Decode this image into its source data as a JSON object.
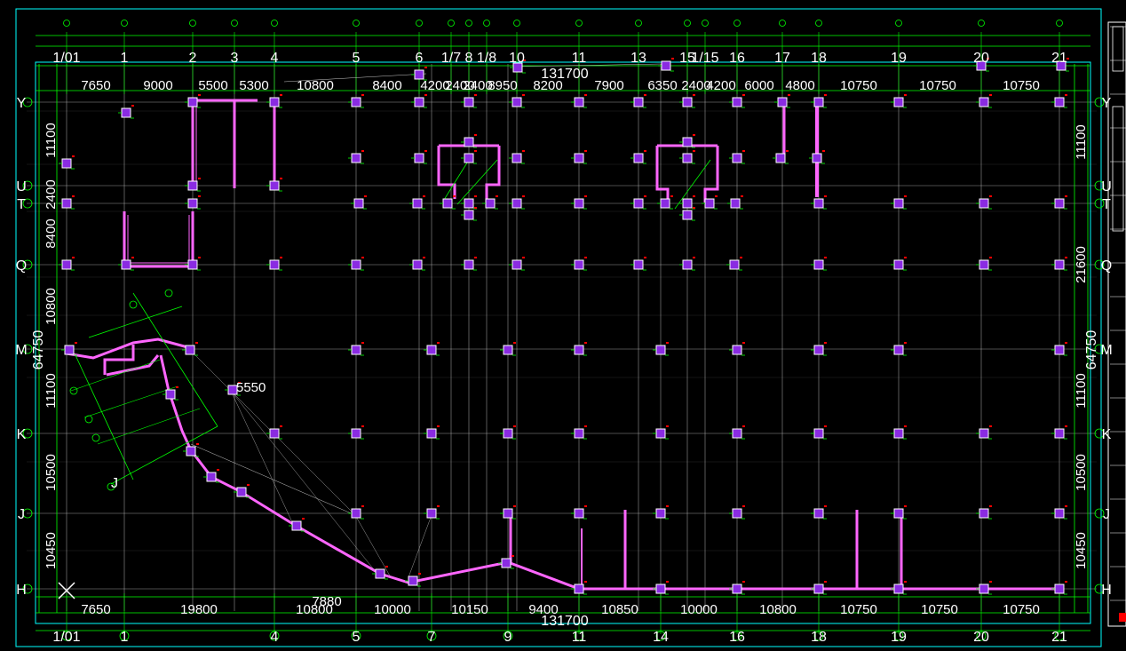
{
  "colors": {
    "background": "#000000",
    "grid": "#c8c8c8",
    "dim": "#00ff00",
    "wall": "#ff66ff",
    "column_fill": "#8a2be2",
    "column_edge": "#ffffff",
    "text": "#ffffff",
    "frame": "#00ffff",
    "marker": "#ff0000"
  },
  "axes_x_top": [
    "1/01",
    "1",
    "2",
    "3",
    "4",
    "5",
    "6",
    "1/7",
    "8",
    "1/8",
    "10",
    "11",
    "13",
    "15",
    "1/15",
    "16",
    "17",
    "18",
    "19",
    "20",
    "21"
  ],
  "axes_x_bottom": [
    "1/01",
    "1",
    "4",
    "5",
    "7",
    "9",
    "11",
    "14",
    "16",
    "18",
    "19",
    "20",
    "21"
  ],
  "axes_y": [
    "Y",
    "U",
    "T",
    "Q",
    "M",
    "K",
    "J",
    "H"
  ],
  "dims_top": [
    "7650",
    "9000",
    "5500",
    "5300",
    "10800",
    "8400",
    "4200",
    "2400",
    "2400",
    "8950",
    "8200",
    "7900",
    "6350",
    "2400",
    "4200",
    "6000",
    "4800",
    "10750",
    "10750",
    "10750"
  ],
  "dims_top_total": "131700",
  "dims_bottom": [
    "7650",
    "19800",
    "10800",
    "10000",
    "10150",
    "9400",
    "10850",
    "10000",
    "10800",
    "10750",
    "10750",
    "10750"
  ],
  "dims_bottom_total": "131700",
  "dims_bottom_extra": "7880",
  "dims_left": [
    "11100",
    "2400",
    "8400",
    "10800",
    "11100",
    "10500",
    "10450"
  ],
  "dims_left_total": "64750",
  "dims_right": [
    "11100",
    "21600",
    "11100",
    "10500",
    "10450"
  ],
  "dims_right_total": "64750",
  "misc_labels": {
    "dim_5550": "5550",
    "inclined_axis_j": "J"
  }
}
